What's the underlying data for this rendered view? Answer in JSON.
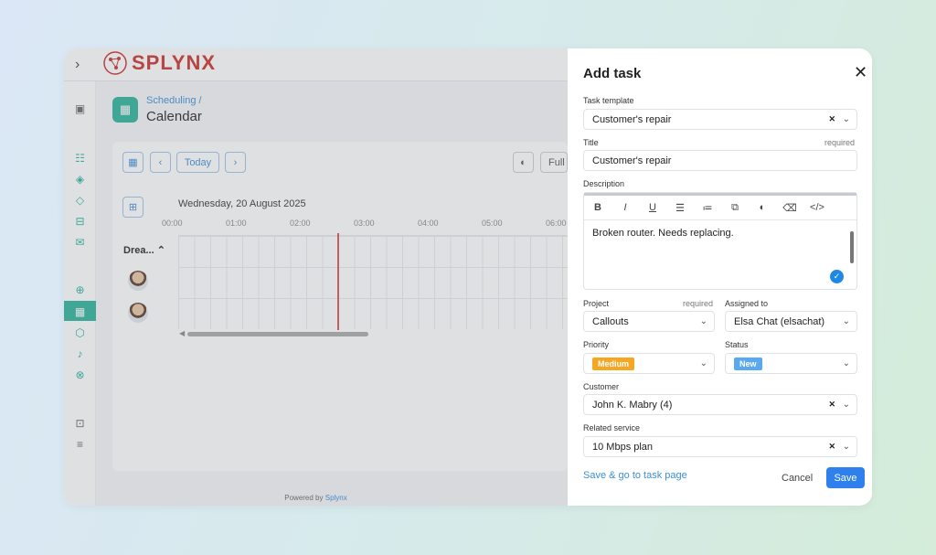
{
  "app": {
    "logo_text": "SPLYNX",
    "breadcrumb": "Scheduling /",
    "page_title": "Calendar",
    "toolbar": {
      "today_label": "Today",
      "full_label": "Full"
    },
    "date_label": "Wednesday, 20 August 2025",
    "hours": [
      "00:00",
      "01:00",
      "02:00",
      "03:00",
      "04:00",
      "05:00",
      "06:00"
    ],
    "group_label": "Drea...",
    "powered_by": "Powered by",
    "powered_brand": "Splynx"
  },
  "dialog": {
    "title": "Add task",
    "task_template": {
      "label": "Task template",
      "value": "Customer's repair"
    },
    "title_field": {
      "label": "Title",
      "required": "required",
      "value": "Customer's repair"
    },
    "description": {
      "label": "Description",
      "text": "Broken router. Needs replacing."
    },
    "editor_toolbar": [
      "B",
      "I",
      "U",
      "ordered-list-icon",
      "unordered-list-icon",
      "copy-icon",
      "palette-icon",
      "eraser-icon",
      "code-icon"
    ],
    "project": {
      "label": "Project",
      "required": "required",
      "value": "Callouts"
    },
    "assigned_to": {
      "label": "Assigned to",
      "value": "Elsa Chat (elsachat)"
    },
    "priority": {
      "label": "Priority",
      "value": "Medium",
      "color": "#f5a623"
    },
    "status": {
      "label": "Status",
      "value": "New",
      "color": "#5aa9f0"
    },
    "customer": {
      "label": "Customer",
      "value": "John K. Mabry (4)"
    },
    "related_service": {
      "label": "Related service",
      "value": "10 Mbps plan"
    },
    "save_go_label": "Save & go to task page",
    "cancel_label": "Cancel",
    "save_label": "Save"
  },
  "colors": {
    "accent": "#2bb39a",
    "primary": "#2f80ed",
    "link": "#3b8fd9"
  }
}
